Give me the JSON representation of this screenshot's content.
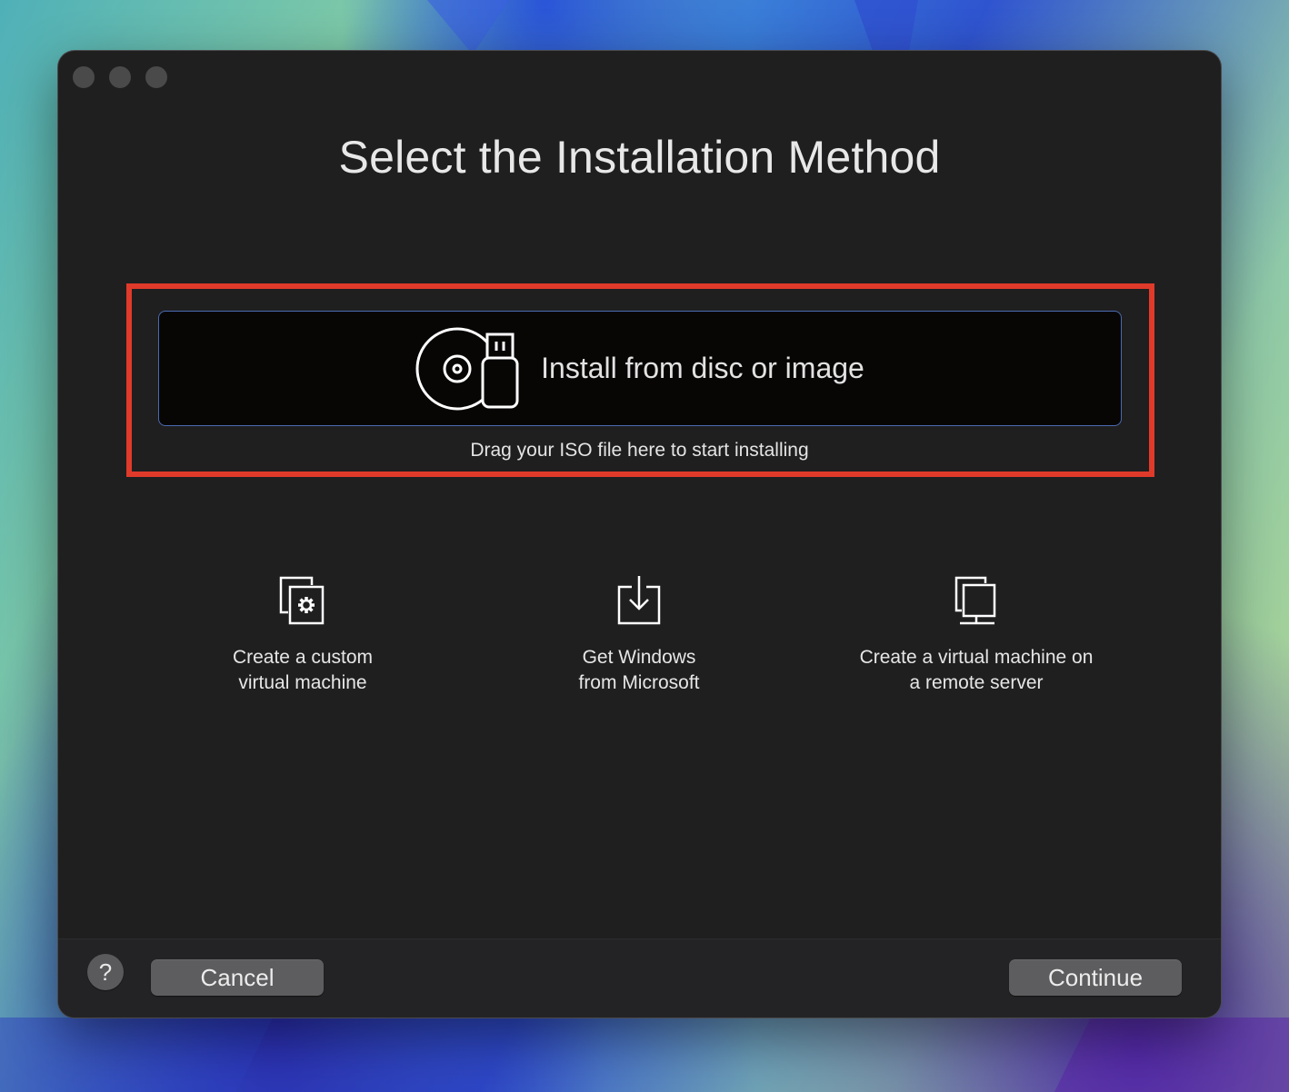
{
  "window": {
    "title": "Select the Installation Method"
  },
  "primary_option": {
    "label": "Install from disc or image",
    "hint": "Drag your ISO file here to start installing",
    "icon": "disc-usb-icon"
  },
  "options": [
    {
      "line1": "Create a custom",
      "line2": "virtual machine",
      "icon": "custom-vm-gear-icon"
    },
    {
      "line1": "Get Windows",
      "line2": "from Microsoft",
      "icon": "download-icon"
    },
    {
      "line1": "Create a virtual machine on",
      "line2": "a remote server",
      "icon": "remote-server-icon"
    }
  ],
  "footer": {
    "help_label": "?",
    "cancel_label": "Cancel",
    "continue_label": "Continue"
  },
  "colors": {
    "highlight": "#e03a2a",
    "window_bg": "#1f1f20",
    "button_bg": "#5d5d60"
  }
}
